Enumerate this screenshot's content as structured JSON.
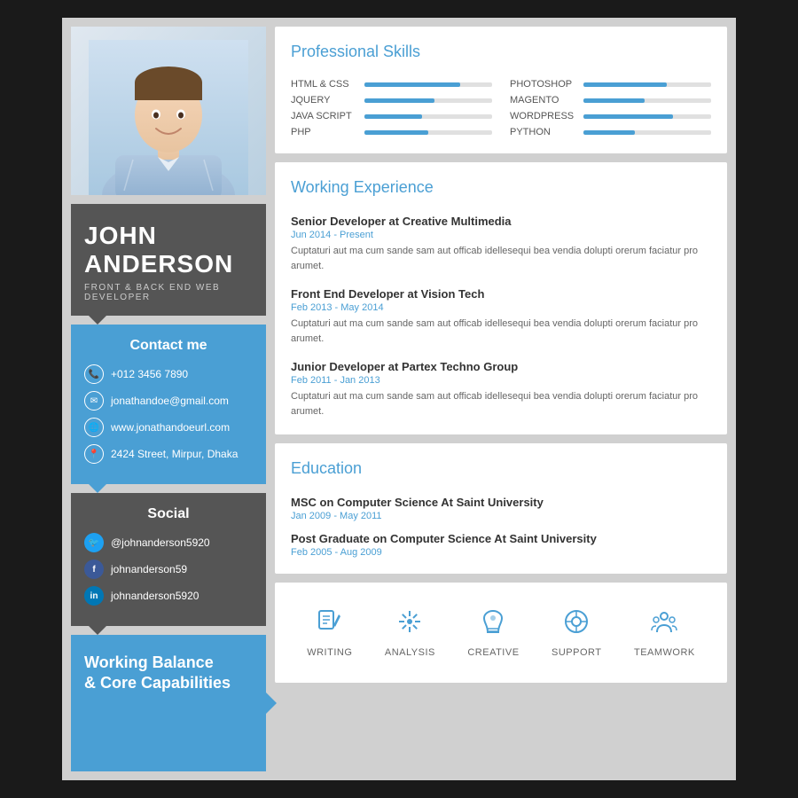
{
  "person": {
    "first_name": "JOHN",
    "last_name": "ANDERSON",
    "title": "FRONT & BACK END WEB DEVELOPER"
  },
  "contact": {
    "section_title": "Contact me",
    "phone": "+012 3456 7890",
    "email": "jonathandoe@gmail.com",
    "website": "www.jonathandoeurl.com",
    "address": "2424 Street, Mirpur, Dhaka"
  },
  "social": {
    "section_title": "Social",
    "twitter": "@johnanderson5920",
    "facebook": "johnanderson59",
    "linkedin": "johnanderson5920"
  },
  "capabilities": {
    "title_line1": "Working Balance",
    "title_line2": "& Core Capabilities",
    "icons": [
      {
        "label": "WRITING",
        "symbol": "✎"
      },
      {
        "label": "ANALYSIS",
        "symbol": "✦"
      },
      {
        "label": "CREATIVE",
        "symbol": "★"
      },
      {
        "label": "SUPPORT",
        "symbol": "❋"
      },
      {
        "label": "TEAMWORK",
        "symbol": "✿"
      }
    ]
  },
  "skills": {
    "title": "Professional Skills",
    "items_left": [
      {
        "name": "HTML & CSS",
        "pct": 75
      },
      {
        "name": "JQUERY",
        "pct": 55
      },
      {
        "name": "JAVA SCRIPT",
        "pct": 45
      },
      {
        "name": "PHP",
        "pct": 50
      }
    ],
    "items_right": [
      {
        "name": "PHOTOSHOP",
        "pct": 65
      },
      {
        "name": "MAGENTO",
        "pct": 48
      },
      {
        "name": "WORDPRESS",
        "pct": 70
      },
      {
        "name": "PYTHON",
        "pct": 40
      }
    ]
  },
  "experience": {
    "title": "Working Experience",
    "items": [
      {
        "job_title": "Senior Developer at Creative Multimedia",
        "date": "Jun 2014 - Present",
        "desc": "Cuptaturi aut ma cum sande sam aut officab idellesequi bea vendia dolupti orerum faciatur pro arumet."
      },
      {
        "job_title": "Front End Developer at Vision Tech",
        "date": "Feb 2013 - May 2014",
        "desc": "Cuptaturi aut ma cum sande sam aut officab idellesequi bea vendia dolupti orerum faciatur pro arumet."
      },
      {
        "job_title": "Junior Developer at Partex Techno Group",
        "date": "Feb 2011 - Jan 2013",
        "desc": "Cuptaturi aut ma cum sande sam aut officab idellesequi bea vendia dolupti orerum faciatur pro arumet."
      }
    ]
  },
  "education": {
    "title": "Education",
    "items": [
      {
        "degree": "MSC on Computer Science At Saint University",
        "date": "Jan 2009 - May 2011"
      },
      {
        "degree": "Post Graduate on Computer Science At Saint University",
        "date": "Feb 2005 - Aug 2009"
      }
    ]
  }
}
